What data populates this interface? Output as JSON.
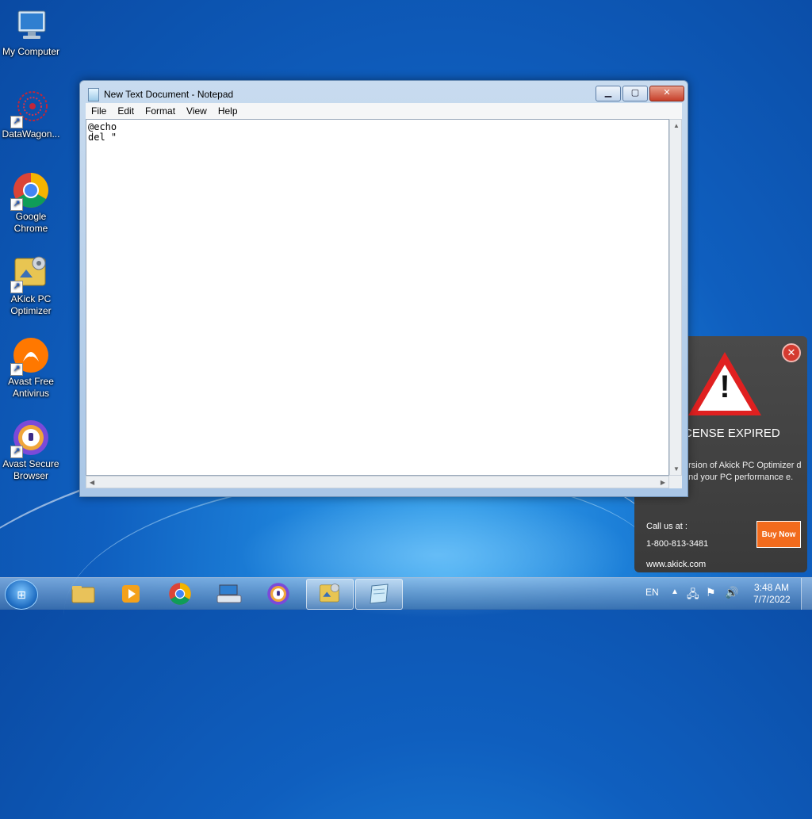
{
  "desktop": {
    "icons": [
      {
        "label": "My Computer",
        "icon": "computer-icon"
      },
      {
        "label": "DataWagon...",
        "icon": "datawagon-icon"
      },
      {
        "label": "Google Chrome",
        "icon": "chrome-icon"
      },
      {
        "label": "AKick PC Optimizer",
        "icon": "akick-icon"
      },
      {
        "label": "Avast Free Antivirus",
        "icon": "avast-antivirus-icon"
      },
      {
        "label": "Avast Secure Browser",
        "icon": "avast-browser-icon"
      }
    ]
  },
  "notepad": {
    "title": "New Text Document - Notepad",
    "menu": [
      "File",
      "Edit",
      "Format",
      "View",
      "Help"
    ],
    "content": "@echo\ndel \"",
    "controls": {
      "minimize": "▁",
      "maximize": "▢",
      "close": "✕"
    }
  },
  "popup": {
    "title": "CENSE EXPIRED",
    "body": "ersion of Akick PC Optimizer d and your PC performance e.",
    "call_label": "Call us at :",
    "phone": "1-800-813-3481",
    "website": "www.akick.com",
    "buy_label": "Buy Now",
    "close_label": "✕"
  },
  "taskbar": {
    "apps": [
      {
        "name": "explorer",
        "icon": "folder-icon",
        "glyph": "📁"
      },
      {
        "name": "media-player",
        "icon": "media-player-icon",
        "glyph": "▶"
      },
      {
        "name": "chrome",
        "icon": "chrome-icon",
        "glyph": "●"
      },
      {
        "name": "keyboard-app",
        "icon": "keyboard-icon",
        "glyph": "⌨"
      },
      {
        "name": "avast-browser",
        "icon": "avast-browser-icon",
        "glyph": "◉"
      },
      {
        "name": "akick",
        "icon": "akick-icon",
        "glyph": "⚙"
      },
      {
        "name": "notepad",
        "icon": "notepad-icon",
        "glyph": "▤"
      }
    ],
    "language": "EN",
    "time": "3:48 AM",
    "date": "7/7/2022"
  },
  "colors": {
    "popup_buy": "#f26b1d",
    "close_red": "#d43b30"
  }
}
